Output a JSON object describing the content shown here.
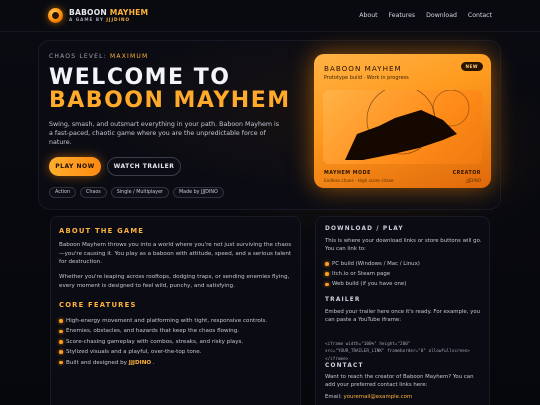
{
  "nav": {
    "brand_prefix": "BABOON ",
    "brand_highlight": "MAYHEM",
    "brand_sub_prefix": "A GAME BY ",
    "brand_sub_highlight": "JJJDINO",
    "links": [
      "About",
      "Features",
      "Download",
      "Contact"
    ]
  },
  "hero": {
    "chaos_label": "CHAOS LEVEL: ",
    "chaos_value": "MAXIMUM",
    "title_line1": "WELCOME TO",
    "title_line2": "BABOON MAYHEM",
    "description": "Swing, smash, and outsmart everything in your path. Baboon Mayhem is a fast-paced, chaotic game where you are the unpredictable force of nature.",
    "play_label": "PLAY NOW",
    "trailer_label": "WATCH TRAILER",
    "tags": [
      "Action",
      "Chaos",
      "Single / Multiplayer",
      "Made by JJJDINO"
    ]
  },
  "card": {
    "title": "BABOON MAYHEM",
    "subtitle": "Prototype build · Work in progress",
    "badge": "NEW",
    "footer_left_title": "MAYHEM MODE",
    "footer_left_sub": "Endless chaos · High score chase",
    "footer_right_title": "CREATOR",
    "footer_right_sub": "JJJDINO"
  },
  "about": {
    "title": "ABOUT THE GAME",
    "para1": "Baboon Mayhem throws you into a world where you're not just surviving the chaos—you're causing it. You play as a baboon with attitude, speed, and a serious talent for destruction.",
    "para2": "Whether you're leaping across rooftops, dodging traps, or sending enemies flying, every moment is designed to feel wild, punchy, and satisfying."
  },
  "features": {
    "title": "CORE FEATURES",
    "items": [
      "High-energy movement and platforming with tight, responsive controls.",
      "Enemies, obstacles, and hazards that keep the chaos flowing.",
      "Score-chasing gameplay with combos, streaks, and risky plays.",
      "Stylized visuals and a playful, over-the-top tone."
    ],
    "built_prefix": "Built and designed by ",
    "built_name": "JJJDINO",
    "built_suffix": " ."
  },
  "download": {
    "title": "DOWNLOAD / PLAY",
    "text": "This is where your download links or store buttons will go. You can link to:",
    "items": [
      "PC build (Windows / Mac / Linux)",
      "Itch.io or Steam page",
      "Web build (if you have one)"
    ]
  },
  "trailer": {
    "title": "TRAILER",
    "text": "Embed your trailer here once it's ready. For example, you can paste a YouTube iframe:",
    "code_line1": "<iframe width=\"100%\" height=\"200\"",
    "code_line2": "src=\"YOUR_TRAILER_LINK\" frameborder=\"0\" allowfullscreen>",
    "code_line3": "</iframe>"
  },
  "contact": {
    "title": "CONTACT",
    "text": "Want to reach the creator of Baboon Mayhem? You can add your preferred contact links here:",
    "email_label": "Email: ",
    "email": "youremail@example.com"
  }
}
